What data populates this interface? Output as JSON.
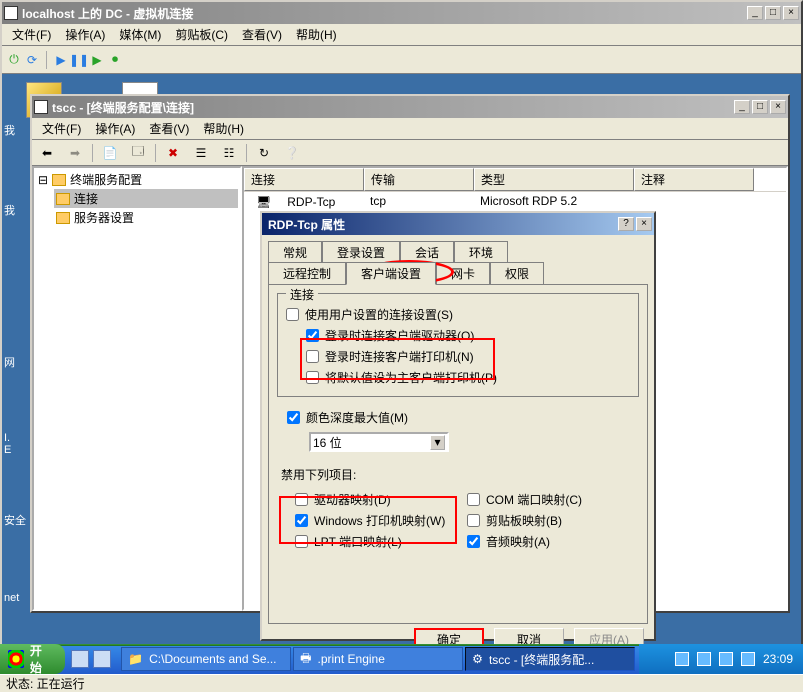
{
  "vm": {
    "title": "localhost 上的 DC - 虚拟机连接",
    "menu": [
      "文件(F)",
      "操作(A)",
      "媒体(M)",
      "剪贴板(C)",
      "查看(V)",
      "帮助(H)"
    ],
    "status": "状态: 正在运行"
  },
  "mmc": {
    "title": "tscc - [终端服务配置\\连接]",
    "menu": [
      "文件(F)",
      "操作(A)",
      "查看(V)",
      "帮助(H)"
    ],
    "tree": {
      "root": "终端服务配置",
      "children": [
        "连接",
        "服务器设置"
      ]
    },
    "list": {
      "headers": [
        "连接",
        "传输",
        "类型",
        "注释"
      ],
      "row": [
        "RDP-Tcp",
        "tcp",
        "Microsoft RDP 5.2",
        ""
      ]
    }
  },
  "dlg": {
    "title": "RDP-Tcp 属性",
    "tabs_row1": [
      "常规",
      "登录设置",
      "会话",
      "环境"
    ],
    "tabs_row2": [
      "远程控制",
      "客户端设置",
      "网卡",
      "权限"
    ],
    "group_connect": "连接",
    "chk_useuser": "使用用户设置的连接设置(S)",
    "chk_drive": "登录时连接客户端驱动器(O)",
    "chk_printer": "登录时连接客户端打印机(N)",
    "chk_default": "将默认值设为主客户端打印机(P)",
    "chk_color": "颜色深度最大值(M)",
    "color_value": "16 位",
    "disable_label": "禁用下列项目:",
    "dis_drive": "驱动器映射(D)",
    "dis_com": "COM 端口映射(C)",
    "dis_winprn": "Windows 打印机映射(W)",
    "dis_clip": "剪贴板映射(B)",
    "dis_lpt": "LPT 端口映射(L)",
    "dis_audio": "音频映射(A)",
    "btn_ok": "确定",
    "btn_cancel": "取消",
    "btn_apply": "应用(A)"
  },
  "taskbar": {
    "start": "开始",
    "task1": "C:\\Documents and Se...",
    "task2": ".print Engine",
    "task3": "tscc - [终端服务配...",
    "time": "23:09"
  }
}
